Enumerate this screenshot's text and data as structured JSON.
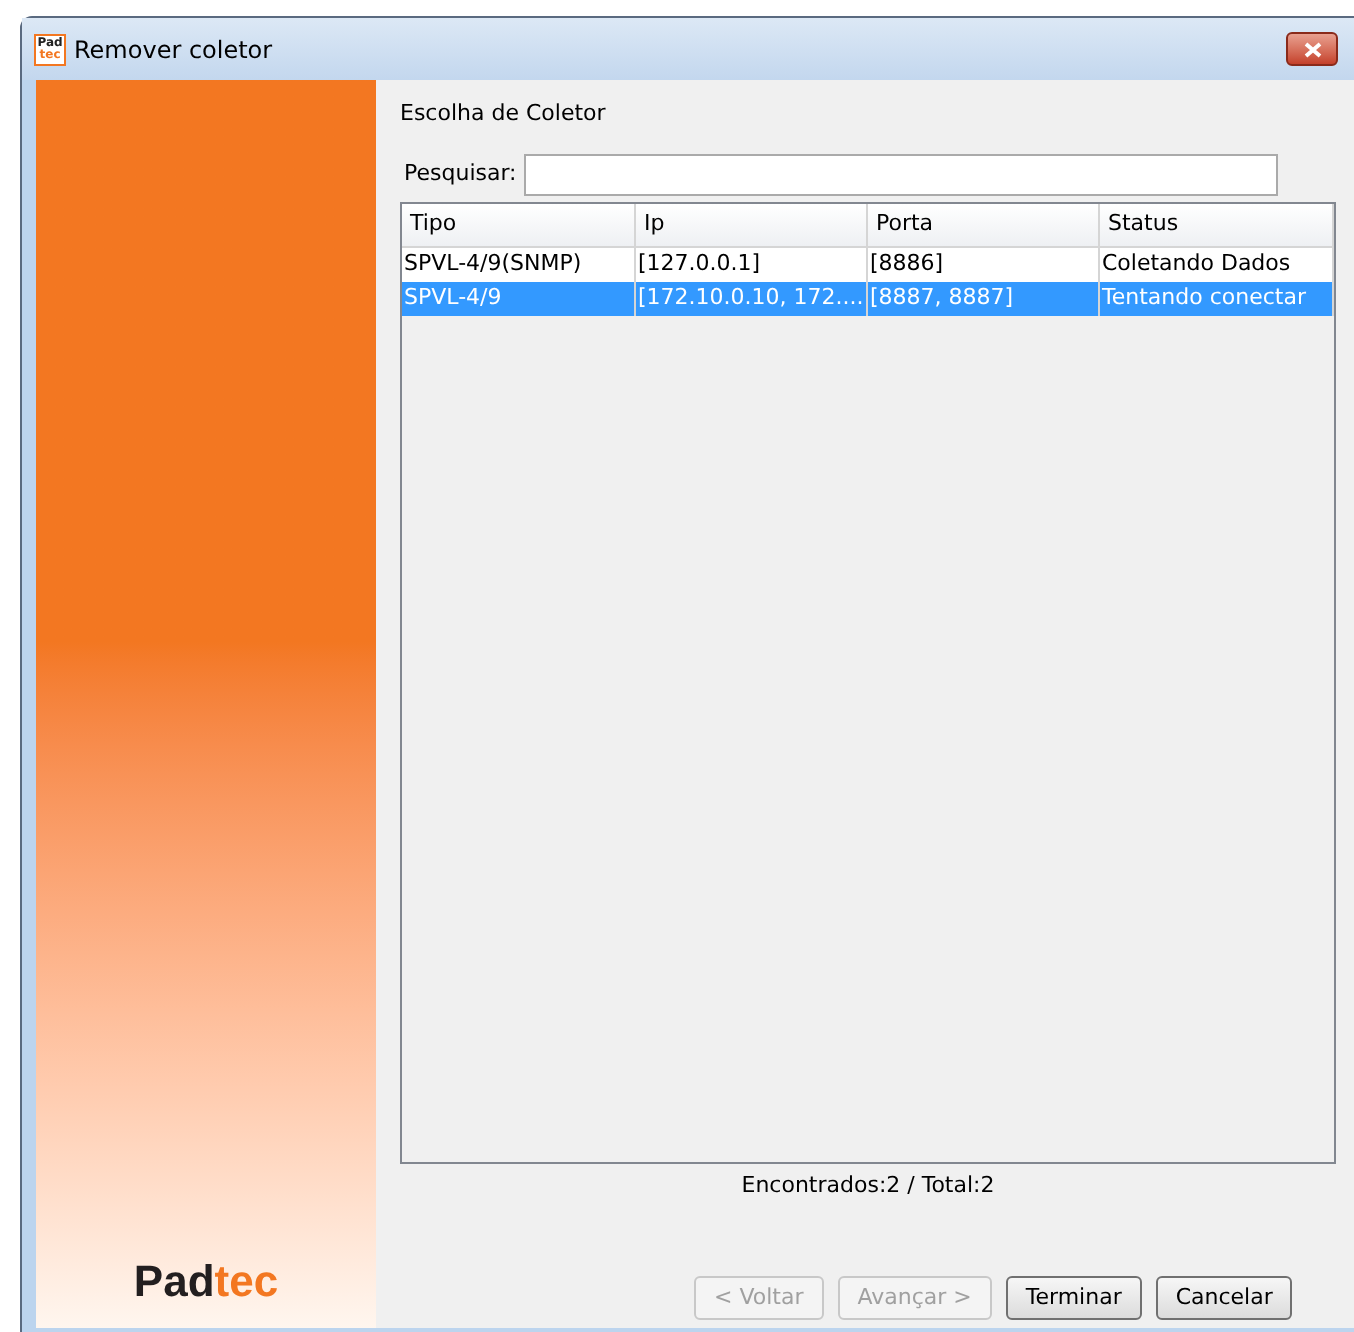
{
  "window": {
    "title": "Remover coletor",
    "icon": {
      "top": "Pad",
      "bottom": "tec"
    }
  },
  "logo": {
    "dark": "Pad",
    "accent": "tec"
  },
  "heading": "Escolha de Coletor",
  "search": {
    "label": "Pesquisar:"
  },
  "table": {
    "columns": [
      "Tipo",
      "Ip",
      "Porta",
      "Status"
    ],
    "rows": [
      {
        "cells": [
          "SPVL-4/9(SNMP)",
          "[127.0.0.1]",
          "[8886]",
          "Coletando Dados"
        ],
        "selected": false
      },
      {
        "cells": [
          "SPVL-4/9",
          "[172.10.0.10, 172....",
          "[8887, 8887]",
          "Tentando conectar"
        ],
        "selected": true
      }
    ]
  },
  "summary": "Encontrados:2 / Total:2",
  "buttons": [
    {
      "label": "< Voltar",
      "disabled": true
    },
    {
      "label": "Avançar >",
      "disabled": true
    },
    {
      "label": "Terminar",
      "disabled": false
    },
    {
      "label": "Cancelar",
      "disabled": false
    }
  ]
}
